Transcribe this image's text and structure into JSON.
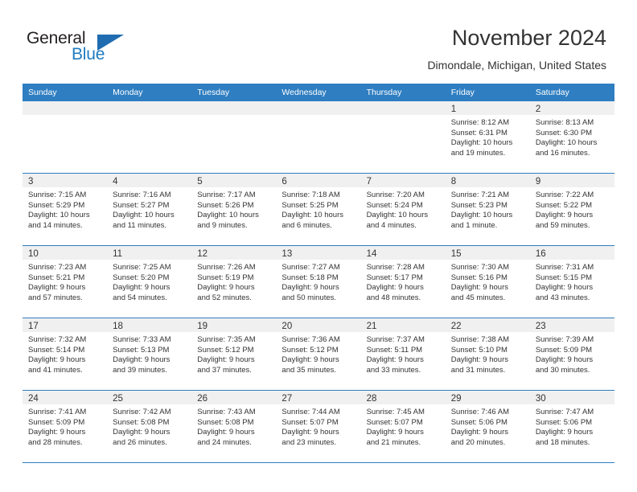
{
  "brand": {
    "name_part1": "General",
    "name_part2": "Blue",
    "accent_color": "#1f7bc1",
    "triangle_color": "#1f6cb0"
  },
  "header": {
    "title": "November 2024",
    "location": "Dimondale, Michigan, United States"
  },
  "theme": {
    "header_row_bg": "#2f7ec1",
    "daynum_band_bg": "#f0f0f0",
    "row_divider": "#2f7ec1",
    "text_color": "#333333"
  },
  "weekdays": [
    "Sunday",
    "Monday",
    "Tuesday",
    "Wednesday",
    "Thursday",
    "Friday",
    "Saturday"
  ],
  "labels": {
    "sunrise": "Sunrise:",
    "sunset": "Sunset:",
    "daylight": "Daylight:"
  },
  "weeks": [
    [
      {
        "day": "",
        "sunrise": "",
        "sunset": "",
        "daylight_line1": "",
        "daylight_line2": ""
      },
      {
        "day": "",
        "sunrise": "",
        "sunset": "",
        "daylight_line1": "",
        "daylight_line2": ""
      },
      {
        "day": "",
        "sunrise": "",
        "sunset": "",
        "daylight_line1": "",
        "daylight_line2": ""
      },
      {
        "day": "",
        "sunrise": "",
        "sunset": "",
        "daylight_line1": "",
        "daylight_line2": ""
      },
      {
        "day": "",
        "sunrise": "",
        "sunset": "",
        "daylight_line1": "",
        "daylight_line2": ""
      },
      {
        "day": "1",
        "sunrise": "Sunrise: 8:12 AM",
        "sunset": "Sunset: 6:31 PM",
        "daylight_line1": "Daylight: 10 hours",
        "daylight_line2": "and 19 minutes."
      },
      {
        "day": "2",
        "sunrise": "Sunrise: 8:13 AM",
        "sunset": "Sunset: 6:30 PM",
        "daylight_line1": "Daylight: 10 hours",
        "daylight_line2": "and 16 minutes."
      }
    ],
    [
      {
        "day": "3",
        "sunrise": "Sunrise: 7:15 AM",
        "sunset": "Sunset: 5:29 PM",
        "daylight_line1": "Daylight: 10 hours",
        "daylight_line2": "and 14 minutes."
      },
      {
        "day": "4",
        "sunrise": "Sunrise: 7:16 AM",
        "sunset": "Sunset: 5:27 PM",
        "daylight_line1": "Daylight: 10 hours",
        "daylight_line2": "and 11 minutes."
      },
      {
        "day": "5",
        "sunrise": "Sunrise: 7:17 AM",
        "sunset": "Sunset: 5:26 PM",
        "daylight_line1": "Daylight: 10 hours",
        "daylight_line2": "and 9 minutes."
      },
      {
        "day": "6",
        "sunrise": "Sunrise: 7:18 AM",
        "sunset": "Sunset: 5:25 PM",
        "daylight_line1": "Daylight: 10 hours",
        "daylight_line2": "and 6 minutes."
      },
      {
        "day": "7",
        "sunrise": "Sunrise: 7:20 AM",
        "sunset": "Sunset: 5:24 PM",
        "daylight_line1": "Daylight: 10 hours",
        "daylight_line2": "and 4 minutes."
      },
      {
        "day": "8",
        "sunrise": "Sunrise: 7:21 AM",
        "sunset": "Sunset: 5:23 PM",
        "daylight_line1": "Daylight: 10 hours",
        "daylight_line2": "and 1 minute."
      },
      {
        "day": "9",
        "sunrise": "Sunrise: 7:22 AM",
        "sunset": "Sunset: 5:22 PM",
        "daylight_line1": "Daylight: 9 hours",
        "daylight_line2": "and 59 minutes."
      }
    ],
    [
      {
        "day": "10",
        "sunrise": "Sunrise: 7:23 AM",
        "sunset": "Sunset: 5:21 PM",
        "daylight_line1": "Daylight: 9 hours",
        "daylight_line2": "and 57 minutes."
      },
      {
        "day": "11",
        "sunrise": "Sunrise: 7:25 AM",
        "sunset": "Sunset: 5:20 PM",
        "daylight_line1": "Daylight: 9 hours",
        "daylight_line2": "and 54 minutes."
      },
      {
        "day": "12",
        "sunrise": "Sunrise: 7:26 AM",
        "sunset": "Sunset: 5:19 PM",
        "daylight_line1": "Daylight: 9 hours",
        "daylight_line2": "and 52 minutes."
      },
      {
        "day": "13",
        "sunrise": "Sunrise: 7:27 AM",
        "sunset": "Sunset: 5:18 PM",
        "daylight_line1": "Daylight: 9 hours",
        "daylight_line2": "and 50 minutes."
      },
      {
        "day": "14",
        "sunrise": "Sunrise: 7:28 AM",
        "sunset": "Sunset: 5:17 PM",
        "daylight_line1": "Daylight: 9 hours",
        "daylight_line2": "and 48 minutes."
      },
      {
        "day": "15",
        "sunrise": "Sunrise: 7:30 AM",
        "sunset": "Sunset: 5:16 PM",
        "daylight_line1": "Daylight: 9 hours",
        "daylight_line2": "and 45 minutes."
      },
      {
        "day": "16",
        "sunrise": "Sunrise: 7:31 AM",
        "sunset": "Sunset: 5:15 PM",
        "daylight_line1": "Daylight: 9 hours",
        "daylight_line2": "and 43 minutes."
      }
    ],
    [
      {
        "day": "17",
        "sunrise": "Sunrise: 7:32 AM",
        "sunset": "Sunset: 5:14 PM",
        "daylight_line1": "Daylight: 9 hours",
        "daylight_line2": "and 41 minutes."
      },
      {
        "day": "18",
        "sunrise": "Sunrise: 7:33 AM",
        "sunset": "Sunset: 5:13 PM",
        "daylight_line1": "Daylight: 9 hours",
        "daylight_line2": "and 39 minutes."
      },
      {
        "day": "19",
        "sunrise": "Sunrise: 7:35 AM",
        "sunset": "Sunset: 5:12 PM",
        "daylight_line1": "Daylight: 9 hours",
        "daylight_line2": "and 37 minutes."
      },
      {
        "day": "20",
        "sunrise": "Sunrise: 7:36 AM",
        "sunset": "Sunset: 5:12 PM",
        "daylight_line1": "Daylight: 9 hours",
        "daylight_line2": "and 35 minutes."
      },
      {
        "day": "21",
        "sunrise": "Sunrise: 7:37 AM",
        "sunset": "Sunset: 5:11 PM",
        "daylight_line1": "Daylight: 9 hours",
        "daylight_line2": "and 33 minutes."
      },
      {
        "day": "22",
        "sunrise": "Sunrise: 7:38 AM",
        "sunset": "Sunset: 5:10 PM",
        "daylight_line1": "Daylight: 9 hours",
        "daylight_line2": "and 31 minutes."
      },
      {
        "day": "23",
        "sunrise": "Sunrise: 7:39 AM",
        "sunset": "Sunset: 5:09 PM",
        "daylight_line1": "Daylight: 9 hours",
        "daylight_line2": "and 30 minutes."
      }
    ],
    [
      {
        "day": "24",
        "sunrise": "Sunrise: 7:41 AM",
        "sunset": "Sunset: 5:09 PM",
        "daylight_line1": "Daylight: 9 hours",
        "daylight_line2": "and 28 minutes."
      },
      {
        "day": "25",
        "sunrise": "Sunrise: 7:42 AM",
        "sunset": "Sunset: 5:08 PM",
        "daylight_line1": "Daylight: 9 hours",
        "daylight_line2": "and 26 minutes."
      },
      {
        "day": "26",
        "sunrise": "Sunrise: 7:43 AM",
        "sunset": "Sunset: 5:08 PM",
        "daylight_line1": "Daylight: 9 hours",
        "daylight_line2": "and 24 minutes."
      },
      {
        "day": "27",
        "sunrise": "Sunrise: 7:44 AM",
        "sunset": "Sunset: 5:07 PM",
        "daylight_line1": "Daylight: 9 hours",
        "daylight_line2": "and 23 minutes."
      },
      {
        "day": "28",
        "sunrise": "Sunrise: 7:45 AM",
        "sunset": "Sunset: 5:07 PM",
        "daylight_line1": "Daylight: 9 hours",
        "daylight_line2": "and 21 minutes."
      },
      {
        "day": "29",
        "sunrise": "Sunrise: 7:46 AM",
        "sunset": "Sunset: 5:06 PM",
        "daylight_line1": "Daylight: 9 hours",
        "daylight_line2": "and 20 minutes."
      },
      {
        "day": "30",
        "sunrise": "Sunrise: 7:47 AM",
        "sunset": "Sunset: 5:06 PM",
        "daylight_line1": "Daylight: 9 hours",
        "daylight_line2": "and 18 minutes."
      }
    ]
  ]
}
